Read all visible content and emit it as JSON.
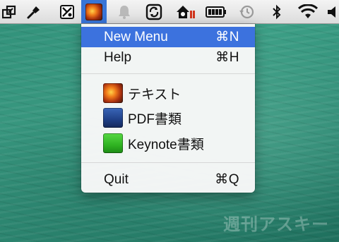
{
  "menubar": {
    "icons": [
      "resize-window-icon",
      "pen-tool-icon",
      "scissor-tool-icon",
      "app-menu-icon",
      "notification-bell-icon",
      "sync-app-icon",
      "home-recording-icon",
      "battery-icon",
      "time-machine-icon",
      "bluetooth-icon",
      "wifi-icon",
      "volume-icon"
    ]
  },
  "menu": {
    "items": [
      {
        "label": "New Menu",
        "shortcut": "⌘N",
        "highlighted": true
      },
      {
        "label": "Help",
        "shortcut": "⌘H"
      },
      {
        "label": "テキスト",
        "icon": "text-doc-icon"
      },
      {
        "label": "PDF書類",
        "icon": "pdf-doc-icon"
      },
      {
        "label": "Keynote書類",
        "icon": "keynote-doc-icon"
      },
      {
        "label": "Quit",
        "shortcut": "⌘Q"
      }
    ]
  },
  "watermark": "週刊アスキー",
  "colors": {
    "highlight": "#3c72de",
    "active_menubar_item": "#3875d7"
  }
}
